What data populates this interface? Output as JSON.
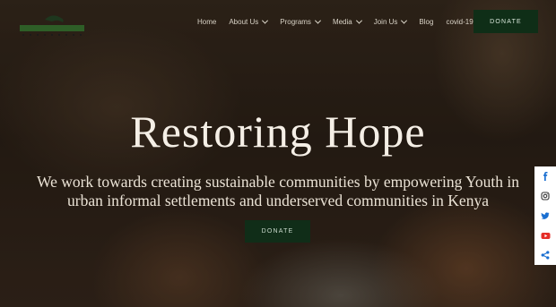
{
  "nav": {
    "items": [
      {
        "label": "Home",
        "has_dropdown": false
      },
      {
        "label": "About Us",
        "has_dropdown": true
      },
      {
        "label": "Programs",
        "has_dropdown": true
      },
      {
        "label": "Media",
        "has_dropdown": true
      },
      {
        "label": "Join Us",
        "has_dropdown": true
      },
      {
        "label": "Blog",
        "has_dropdown": false
      },
      {
        "label": "covid-19",
        "has_dropdown": false
      }
    ],
    "donate_label": "DONATE"
  },
  "hero": {
    "title": "Restoring Hope",
    "subtitle": "We work towards creating sustainable communities by empowering Youth in urban informal settlements and underserved communities in Kenya",
    "donate_label": "DONATE"
  },
  "social": [
    "facebook-icon",
    "instagram-icon",
    "twitter-icon",
    "youtube-icon",
    "share-icon"
  ],
  "colors": {
    "donate_bg": "#0f2e17",
    "social_icon": "#1a6fd1",
    "youtube": "#e52d27"
  }
}
